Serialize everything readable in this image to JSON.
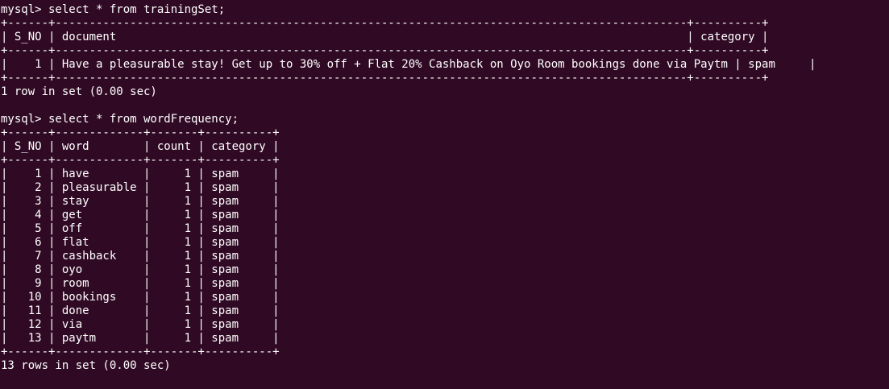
{
  "terminal": {
    "colors": {
      "background": "#300a24",
      "foreground": "#ffffff"
    },
    "lines": [
      "mysql> select * from trainingSet;",
      "+------+---------------------------------------------------------------------------------------------+----------+",
      "| S_NO | document                                                                                    | category |",
      "+------+---------------------------------------------------------------------------------------------+----------+",
      "|    1 | Have a pleasurable stay! Get up to 30% off + Flat 20% Cashback on Oyo Room bookings done via Paytm | spam     |",
      "+------+---------------------------------------------------------------------------------------------+----------+",
      "1 row in set (0.00 sec)",
      "",
      "mysql> select * from wordFrequency;",
      "+------+-------------+-------+----------+",
      "| S_NO | word        | count | category |",
      "+------+-------------+-------+----------+",
      "|    1 | have        |     1 | spam     |",
      "|    2 | pleasurable |     1 | spam     |",
      "|    3 | stay        |     1 | spam     |",
      "|    4 | get         |     1 | spam     |",
      "|    5 | off         |     1 | spam     |",
      "|    6 | flat        |     1 | spam     |",
      "|    7 | cashback    |     1 | spam     |",
      "|    8 | oyo         |     1 | spam     |",
      "|    9 | room        |     1 | spam     |",
      "|   10 | bookings    |     1 | spam     |",
      "|   11 | done        |     1 | spam     |",
      "|   12 | via         |     1 | spam     |",
      "|   13 | paytm       |     1 | spam     |",
      "+------+-------------+-------+----------+",
      "13 rows in set (0.00 sec)"
    ]
  }
}
